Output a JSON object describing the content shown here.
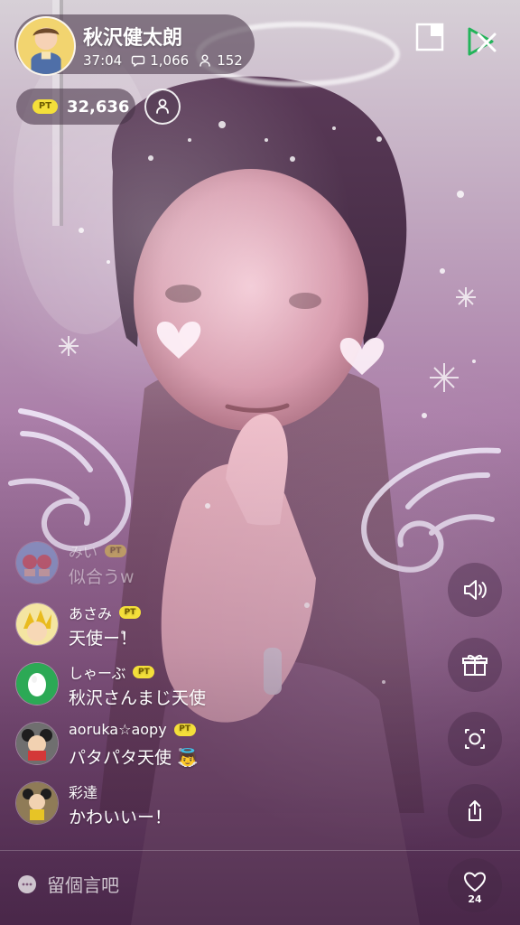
{
  "stream": {
    "streamer_name": "秋沢健太朗",
    "elapsed_time": "37:04",
    "comment_count": "1,066",
    "viewer_count": "152",
    "points": "32,636",
    "pt_badge": "PT"
  },
  "comments": [
    {
      "name": "みい",
      "text": "似合うw",
      "has_pt": true,
      "faded": true
    },
    {
      "name": "あさみ",
      "text": "天使ー！",
      "has_pt": true,
      "faded": false
    },
    {
      "name": "しゃーぶ",
      "text": "秋沢さんまじ天使",
      "has_pt": true,
      "faded": false
    },
    {
      "name": "aoruka☆aopy",
      "text": "パタパタ天使",
      "has_pt": true,
      "faded": false
    },
    {
      "name": "彩達",
      "text": "かわいいー！",
      "has_pt": false,
      "faded": false
    }
  ],
  "input": {
    "placeholder": "留個言吧"
  },
  "actions": {
    "like_count": "24"
  },
  "icons": {
    "close": "close-icon",
    "window": "window-icon",
    "follow": "person-icon",
    "volume": "volume-icon",
    "gift": "gift-icon",
    "screenshot": "camera-icon",
    "share": "share-icon",
    "like": "heart-icon",
    "input": "chat-bubble-icon",
    "comment_count": "chat-icon",
    "viewer_count": "person-icon"
  },
  "colors": {
    "pt_badge": "#f4df3a",
    "accent_green": "#23b45a",
    "overlay_dark": "#463447"
  }
}
